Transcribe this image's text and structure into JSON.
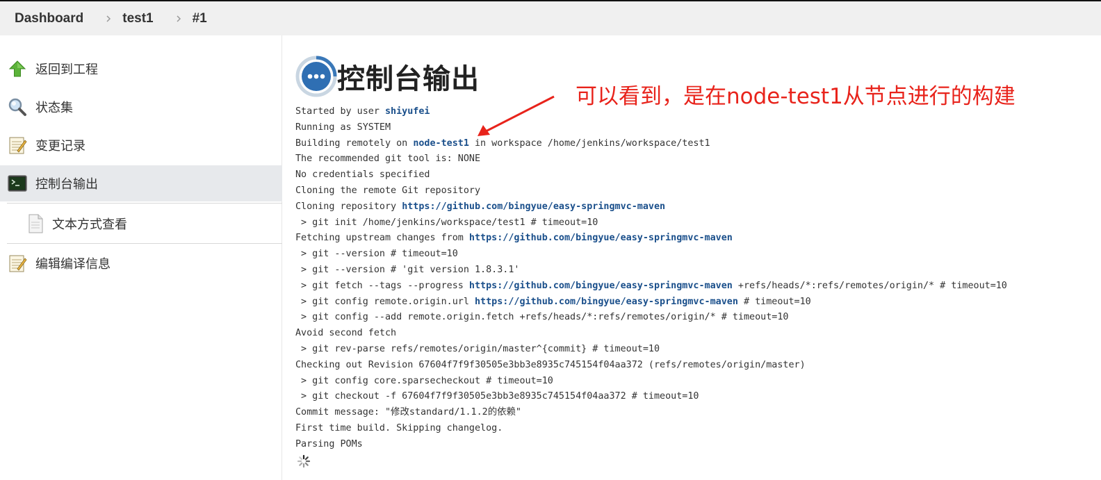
{
  "breadcrumb": {
    "items": [
      "Dashboard",
      "test1",
      "#1"
    ]
  },
  "sidebar": {
    "items": [
      {
        "label": "返回到工程",
        "icon": "up-arrow-icon"
      },
      {
        "label": "状态集",
        "icon": "magnifier-icon"
      },
      {
        "label": "变更记录",
        "icon": "notepad-icon"
      },
      {
        "label": "控制台输出",
        "icon": "terminal-icon",
        "active": true
      },
      {
        "label": "文本方式查看",
        "icon": "document-icon"
      },
      {
        "label": "编辑编译信息",
        "icon": "notepad-icon"
      }
    ]
  },
  "main": {
    "title": "控制台输出",
    "annotation": "可以看到，是在node-test1从节点进行的构建",
    "console": {
      "l1": {
        "pre": "Started by user ",
        "link": "shiyufei"
      },
      "l2": "Running as SYSTEM",
      "l3": {
        "pre": "Building remotely on ",
        "link": "node-test1",
        "post": " in workspace /home/jenkins/workspace/test1"
      },
      "l4": "The recommended git tool is: NONE",
      "l5": "No credentials specified",
      "l6": "Cloning the remote Git repository",
      "l7": {
        "pre": "Cloning repository ",
        "link": "https://github.com/bingyue/easy-springmvc-maven"
      },
      "l8": " > git init /home/jenkins/workspace/test1 # timeout=10",
      "l9": {
        "pre": "Fetching upstream changes from ",
        "link": "https://github.com/bingyue/easy-springmvc-maven"
      },
      "l10": " > git --version # timeout=10",
      "l11": " > git --version # 'git version 1.8.3.1'",
      "l12": {
        "pre": " > git fetch --tags --progress ",
        "link": "https://github.com/bingyue/easy-springmvc-maven",
        "post": " +refs/heads/*:refs/remotes/origin/* # timeout=10"
      },
      "l13": {
        "pre": " > git config remote.origin.url ",
        "link": "https://github.com/bingyue/easy-springmvc-maven",
        "post": " # timeout=10"
      },
      "l14": " > git config --add remote.origin.fetch +refs/heads/*:refs/remotes/origin/* # timeout=10",
      "l15": "Avoid second fetch",
      "l16": " > git rev-parse refs/remotes/origin/master^{commit} # timeout=10",
      "l17": "Checking out Revision 67604f7f9f30505e3bb3e8935c745154f04aa372 (refs/remotes/origin/master)",
      "l18": " > git config core.sparsecheckout # timeout=10",
      "l19": " > git checkout -f 67604f7f9f30505e3bb3e8935c745154f04aa372 # timeout=10",
      "l20": "Commit message: \"修改standard/1.1.2的依赖\"",
      "l21": "First time build. Skipping changelog.",
      "l22": "Parsing POMs"
    }
  },
  "colors": {
    "annotation": "#e8231b",
    "link": "#1a4f8b",
    "breadcrumb_bg": "#f0f0f0",
    "active_item_bg": "#e7e9ec"
  }
}
